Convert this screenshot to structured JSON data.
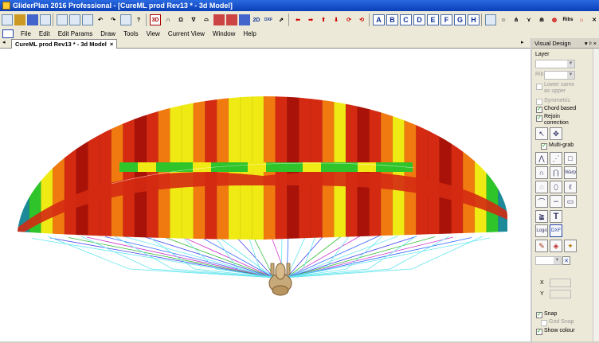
{
  "window": {
    "title": "GliderPlan 2016 Professional - [CureML prod Rev13 * - 3d Model]"
  },
  "toolbar": {
    "btn_3d": "3D",
    "btn_2d": "2D",
    "btn_dxf": "DXF",
    "letters": [
      "A",
      "B",
      "C",
      "D",
      "E",
      "F",
      "G",
      "H"
    ],
    "ribs_label": "Ribs"
  },
  "menu": {
    "items": [
      "File",
      "Edit",
      "Edit Params",
      "Draw",
      "Tools",
      "View",
      "Current View",
      "Window",
      "Help"
    ]
  },
  "tab": {
    "label": "CureML prod Rev13 * - 3d Model",
    "close": "×"
  },
  "panel": {
    "title": "Visual Design",
    "pin": "▾ ᵖ ×",
    "layer_label": "Layer",
    "rib_label": "Rib",
    "lower_same": "Lower same as upper",
    "symmetric": "Symmetric",
    "chord_based": "Chord based",
    "rejoin": "Rejoin correction",
    "multi_grab": "Multi-grab",
    "warp": "Warp",
    "logo": "Logo",
    "dxf": "DXF",
    "text_tool": "T",
    "x_label": "X",
    "y_label": "Y",
    "snap": "Snap",
    "grid_snap": "Grid Snap",
    "show_colour": "Show colour"
  },
  "colors": {
    "red": "#d42a12",
    "dark_red": "#a81208",
    "orange": "#f07a10",
    "yellow": "#f0ea14",
    "green": "#2fc42a",
    "teal": "#1c8a98",
    "lines_cyan": "#66e6ee"
  }
}
